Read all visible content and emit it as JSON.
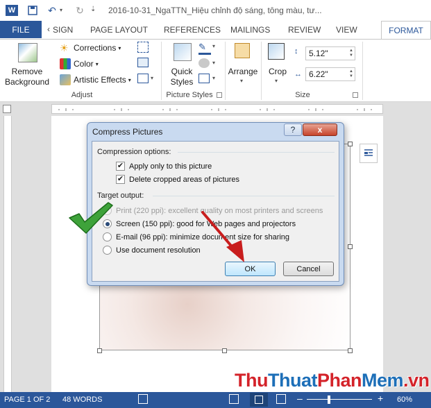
{
  "title_bar": {
    "title": "2016-10-31_NgaTTN_Hiệu chỉnh độ sáng, tông màu, tư..."
  },
  "tabs": {
    "file": "FILE",
    "items": [
      "SIGN",
      "PAGE LAYOUT",
      "REFERENCES",
      "MAILINGS",
      "REVIEW",
      "VIEW"
    ],
    "active": "FORMAT"
  },
  "ribbon": {
    "remove_background": [
      "Remove",
      "Background"
    ],
    "corrections": "Corrections",
    "color": "Color",
    "artistic_effects": "Artistic Effects",
    "adjust_label": "Adjust",
    "quick_styles": [
      "Quick",
      "Styles"
    ],
    "picture_styles_label": "Picture Styles",
    "arrange": "Arrange",
    "crop": "Crop",
    "height": "5.12\"",
    "width": "6.22\"",
    "size_label": "Size"
  },
  "dialog": {
    "title": "Compress Pictures",
    "help": "?",
    "close": "x",
    "compression_options": "Compression options:",
    "apply_only": "Apply only to this picture",
    "apply_only_checked": true,
    "delete_cropped": "Delete cropped areas of pictures",
    "delete_cropped_checked": true,
    "target_output": "Target output:",
    "options": [
      {
        "label": "Print (220 ppi): excellent quality on most printers and screens",
        "selected": false,
        "disabled": true
      },
      {
        "label": "Screen (150 ppi): good for Web pages and projectors",
        "selected": true,
        "disabled": false
      },
      {
        "label": "E-mail (96 ppi): minimize document size for sharing",
        "selected": false,
        "disabled": false
      },
      {
        "label": "Use document resolution",
        "selected": false,
        "disabled": false
      }
    ],
    "ok": "OK",
    "cancel": "Cancel"
  },
  "status_bar": {
    "page": "PAGE 1 OF 2",
    "words": "48 WORDS",
    "zoom": "60%"
  },
  "watermark": {
    "a": "Thu",
    "b": "Thuat",
    "c": "Phan",
    "d": "Mem",
    "e": ".vn"
  },
  "colors": {
    "word_blue": "#2b579a",
    "watermark_red": "#d4232a",
    "watermark_blue": "#1d6fb8",
    "arrow_red": "#c81d1d",
    "check_green": "#3ea23a"
  }
}
